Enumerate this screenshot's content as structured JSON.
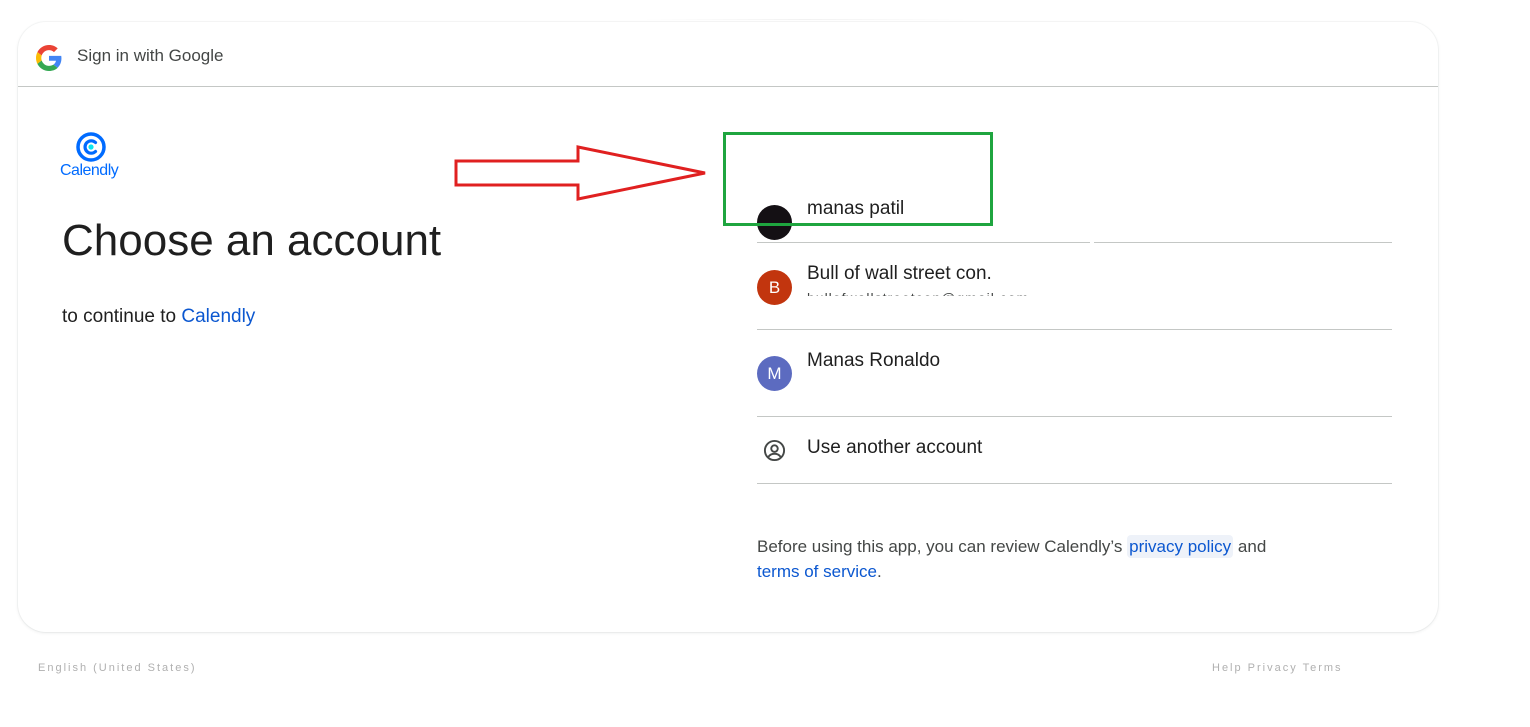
{
  "header": {
    "title": "Sign in with Google",
    "logo_icon": "google-g-icon"
  },
  "client": {
    "logo_icon": "calendly-logo-icon",
    "logo_text": "Calendly",
    "brand_color": "#006bff"
  },
  "main": {
    "heading": "Choose an account",
    "subtitle_prefix": "to continue to",
    "app_name": "Calendly"
  },
  "accounts": [
    {
      "name": "manas patil",
      "avatar_letter": "",
      "avatar_color": "#141014"
    },
    {
      "name": "Bull of wall street con.",
      "email": "bullofwallstreetcon@gmail.com",
      "avatar_letter": "B",
      "avatar_color": "#c2350e"
    },
    {
      "name": "Manas Ronaldo",
      "avatar_letter": "M",
      "avatar_color": "#5c6bc0"
    }
  ],
  "use_another": {
    "label": "Use another account",
    "icon": "account-circle-icon"
  },
  "policy": {
    "text_before": "Before using this app, you can review Calendly’s",
    "privacy_link": "privacy policy",
    "text_and": "and",
    "terms_link": "terms of service",
    "text_end": "."
  },
  "footer": {
    "language": "English (United States)",
    "links": "Help   Privacy   Terms"
  },
  "annotations": {
    "arrow_color": "#e02020",
    "highlight_color": "#1fa53f"
  },
  "colors": {
    "link": "#0b57d0",
    "text": "#1f1f1f",
    "divider": "#c4c7c5"
  }
}
